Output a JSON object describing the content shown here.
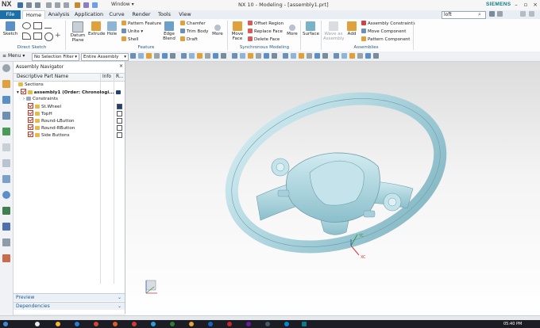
{
  "app": {
    "logo": "NX",
    "window_menu": "Window",
    "title": "NX 10 - Modeling - [assembly1.prt]",
    "brand": "SIEMENS",
    "search_value": "loft"
  },
  "tabs": [
    {
      "label": "File"
    },
    {
      "label": "Home"
    },
    {
      "label": "Analysis"
    },
    {
      "label": "Application"
    },
    {
      "label": "Curve"
    },
    {
      "label": "Render"
    },
    {
      "label": "Tools"
    },
    {
      "label": "View"
    }
  ],
  "ribbon": {
    "sketch": "Sketch",
    "direct_sketch": "Direct Sketch",
    "datum_plane": "Datum Plane",
    "extrude": "Extrude",
    "hole": "Hole",
    "pattern_feature": "Pattern Feature",
    "unite": "Unite",
    "shell": "Shell",
    "edge_blend": "Edge Blend",
    "chamfer": "Chamfer",
    "trim_body": "Trim Body",
    "draft": "Draft",
    "more": "More",
    "feature": "Feature",
    "move_face": "Move Face",
    "offset_region": "Offset Region",
    "replace_face": "Replace Face",
    "delete_face": "Delete Face",
    "more2": "More",
    "synchronous": "Synchronous Modeling",
    "surface": "Surface",
    "more3": "More",
    "wave_geometry_linker": "Wave as Assembly",
    "add": "Add",
    "assembly_constraints": "Assembly Constraints",
    "move_component": "Move Component",
    "pattern_component": "Pattern Component",
    "assemblies": "Assemblies"
  },
  "selection_bar": {
    "menu": "Menu",
    "filter": "No Selection Filter",
    "scope": "Entire Assembly"
  },
  "navigator": {
    "title": "Assembly Navigator",
    "col_name": "Descriptive Part Name",
    "col_info": "Info",
    "col_r": "R...",
    "rows": [
      {
        "label": "Sections"
      },
      {
        "label": "assembly1 (Order: Chronologi..."
      },
      {
        "label": "Constraints"
      },
      {
        "label": "St.Wheel"
      },
      {
        "label": "TopH"
      },
      {
        "label": "Round-LButton"
      },
      {
        "label": "Round-RButton"
      },
      {
        "label": "Side Buttons"
      }
    ],
    "preview": "Preview",
    "dependencies": "Dependencies"
  },
  "graphics": {
    "axis_x": "XC",
    "axis_y": "YC",
    "axis_z": "ZC"
  },
  "taskbar": {
    "time": "05:40 PM"
  },
  "colors": {
    "accent": "#1d6fa8",
    "part_surface": "#b9dee6",
    "brand": "#0a7c88"
  }
}
